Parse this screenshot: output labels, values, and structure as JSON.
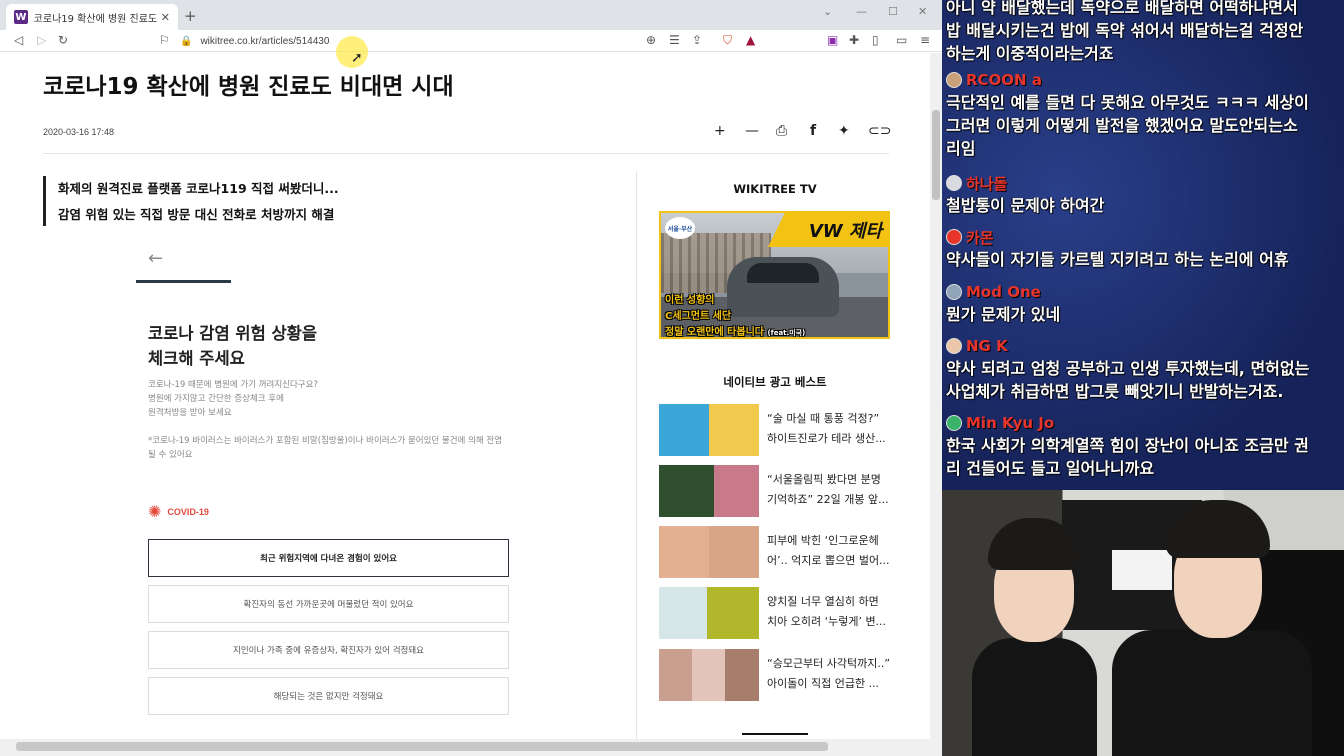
{
  "browser": {
    "tab_title": "코로나19 확산에 병원 진료도 비대면 시대",
    "favicon_letter": "W",
    "url": "wikitree.co.kr/articles/514430"
  },
  "article": {
    "headline": "코로나19 확산에 병원 진료도 비대면 시대",
    "date": "2020-03-16 17:48",
    "quote_lines": [
      "화제의 원격진료 플랫폼 코로나119 직접 써봤더니...",
      "감염 위험 있는 직접 방문 대신 전화로 처방까지 해결"
    ],
    "check_title_lines": [
      "코로나 감염 위험 상황을",
      "체크해 주세요"
    ],
    "check_desc_lines": [
      "코로나-19 때문에 병원에 가기 꺼려지신다구요?",
      "병원에 가지않고 간단한 증상체크 후에",
      "원격처방을 받아 보세요"
    ],
    "check_note": "*코로나-19 바이러스는 바이러스가 포함된 비말(침방울)이나 바이러스가 묻어있던 물건에 의해 전염 될 수 있어요",
    "covid_label": "COVID-19",
    "options": [
      "최근 위험지역에 다녀온 경험이 있어요",
      "확진자의 동선 가까운곳에 머물렀던 적이 있어요",
      "지인이나 가족 중에 유증상자, 확진자가 있어 걱정돼요",
      "해당되는 것은 없지만 걱정돼요"
    ]
  },
  "sidebar": {
    "tv_heading": "WIKITREE TV",
    "tv_brand": "VW 제타",
    "tv_badge": "서울·부산",
    "tv_caption_1": "이런 성향의",
    "tv_caption_2": "C세그먼트 세단",
    "tv_caption_3": "정말 오랜만에 타봅니다",
    "tv_caption_3_small": "(feat.미국)",
    "ads_heading": "네이티브 광고 베스트",
    "ads": [
      {
        "line1": "“술 마실 때 통풍 걱정?”",
        "line2": "하이트진로가 테라 생산..."
      },
      {
        "line1": "“서울올림픽 봤다면 분명",
        "line2": "기억하죠” 22일 개봉 앞..."
      },
      {
        "line1": "피부에 박힌 ‘인그로운헤",
        "line2": "어’.. 억지로 뽑으면 벌어..."
      },
      {
        "line1": "양치질 너무 열심히 하면",
        "line2": "치아 오히려 ‘누렇게’ 변..."
      },
      {
        "line1": "“승모근부터 사각턱까지..”",
        "line2": "아이돌이 직접 언급한 ..."
      }
    ]
  },
  "chat": {
    "messages": [
      {
        "user": "",
        "lines": [
          "아니 약 배달했는데 독약으로 배달하면 어떡하냐면서",
          "밥 배달시키는건 밥에 독약 섞어서 배달하는걸 걱정안",
          "하는게 이중적이라는거죠"
        ]
      },
      {
        "user": "RCOON a",
        "lines": [
          "극단적인 예를 들면 다 못해요 아무것도 ㅋㅋㅋ 세상이",
          "그러면 이렇게 어떻게 발전을 했겠어요 말도안되는소",
          "리임"
        ]
      },
      {
        "user": "하나돌",
        "lines": [
          "철밥통이 문제야 하여간"
        ]
      },
      {
        "user": "카몬",
        "lines": [
          "약사들이 자기들 카르텔 지키려고 하는 논리에 어휴"
        ]
      },
      {
        "user": "Mod One",
        "lines": [
          "뭔가 문제가 있네"
        ]
      },
      {
        "user": "NG K",
        "lines": [
          "약사 되려고 엄청 공부하고 인생 투자했는데, 면허없는",
          "사업체가 취급하면 밥그릇 빼앗기니 반발하는거죠."
        ]
      },
      {
        "user": "Min Kyu Jo",
        "lines": [
          "한국 사회가 의학계열쪽 힘이 장난이 아니죠 조금만 권",
          "리 건들어도 들고 일어나니까요"
        ]
      }
    ]
  },
  "icons": {
    "back": "◁",
    "forward": "▷",
    "reload": "↻",
    "bookmark": "⚐",
    "lock": "🔒",
    "plus": "+",
    "minus": "—",
    "print": "⎙",
    "facebook": "f",
    "twitter": "🐦",
    "link": "🔗",
    "arrow_left": "←",
    "virus": "✺"
  },
  "colors": {
    "chat_name": "#e8352b",
    "covid": "#e44b3c",
    "tv_border": "#f2c313"
  }
}
